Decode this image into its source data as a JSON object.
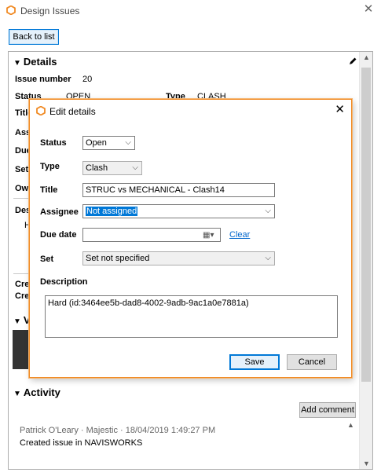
{
  "window": {
    "title": "Design Issues"
  },
  "back_button": "Back to list",
  "details": {
    "heading": "Details",
    "issue_number_label": "Issue number",
    "issue_number": "20",
    "status_label": "Status",
    "status_value": "OPEN",
    "type_label": "Type",
    "type_value": "CLASH",
    "partial_labels": [
      "Title",
      "Ass",
      "Due",
      "Set",
      "Own",
      "Des"
    ],
    "desc_partial": "H",
    "created_partial": [
      "Cre",
      "Cre"
    ]
  },
  "views": {
    "heading_partial": "V"
  },
  "activity": {
    "heading": "Activity",
    "add_comment": "Add comment",
    "entries": [
      {
        "author": "Patrick O'Leary · Majestic  · 18/04/2019 1:49:27 PM",
        "text": "Created issue in NAVISWORKS"
      }
    ]
  },
  "dialog": {
    "title": "Edit details",
    "status_label": "Status",
    "status_value": "Open",
    "type_label": "Type",
    "type_value": "Clash",
    "title_label": "Title",
    "title_value": "STRUC vs MECHANICAL - Clash14",
    "assignee_label": "Assignee",
    "assignee_value": "Not assigned",
    "due_label": "Due date",
    "due_value": "",
    "clear_link": "Clear",
    "set_label": "Set",
    "set_value": "Set not specified",
    "description_label": "Description",
    "description_value": "Hard (id:3464ee5b-dad8-4002-9adb-9ac1a0e7881a)",
    "save": "Save",
    "cancel": "Cancel"
  },
  "colors": {
    "accent": "#f08a24",
    "focus": "#0078d7",
    "link": "#0066cc"
  }
}
